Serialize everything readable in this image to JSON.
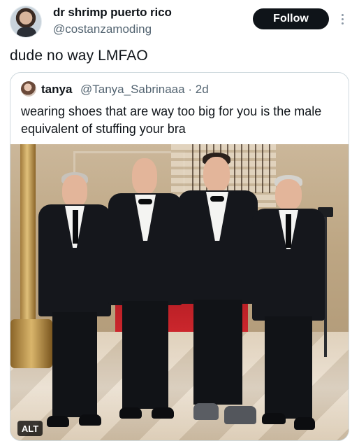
{
  "post": {
    "author_name": "dr shrimp puerto rico",
    "author_handle": "@costanzamoding",
    "follow_label": "Follow",
    "text": "dude no way LMFAO"
  },
  "quote": {
    "author_name": "tanya",
    "author_handle": "@Tanya_Sabrinaaa",
    "separator": "·",
    "age": "2d",
    "text": "wearing shoes that are way too big for you is the male equivalent of stuffing your bra",
    "image_alt_badge": "ALT"
  },
  "icons": {
    "more": "more-vertical-icon"
  },
  "colors": {
    "follow_bg": "#0f1419",
    "secondary_text": "#536471",
    "card_border": "#cfd9de"
  }
}
